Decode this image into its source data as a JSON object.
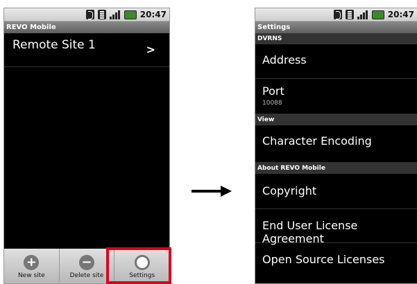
{
  "left": {
    "status_time": "20:47",
    "title": "REVO Mobile",
    "sites": [
      {
        "label": "Remote Site 1",
        "chevron": ">"
      }
    ],
    "bottom": [
      {
        "label": "New site",
        "icon": "add-icon",
        "glyph": "+"
      },
      {
        "label": "Delete site",
        "icon": "remove-icon",
        "glyph": "−"
      },
      {
        "label": "Settings",
        "icon": "gear-icon",
        "glyph": "⚙"
      }
    ],
    "highlight_color": "#e0001b"
  },
  "right": {
    "status_time": "20:47",
    "title": "Settings",
    "sections": {
      "dvrns": "DVRNS",
      "view": "View",
      "about": "About REVO Mobile"
    },
    "prefs": {
      "address": "Address",
      "port": "Port",
      "port_value": "10088",
      "encoding": "Character Encoding",
      "copyright": "Copyright",
      "eula": "End User License Agreement",
      "oss": "Open Source Licenses"
    }
  }
}
